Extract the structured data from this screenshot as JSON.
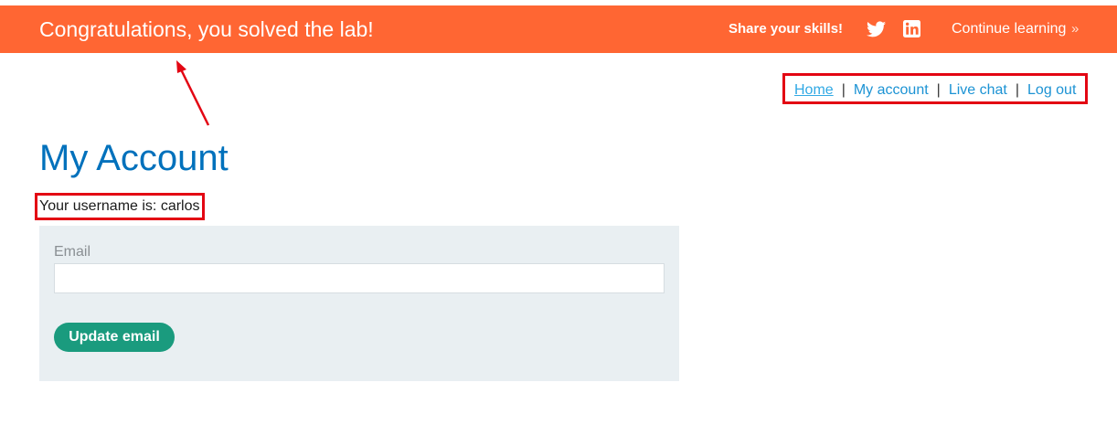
{
  "banner": {
    "message": "Congratulations, you solved the lab!",
    "share_label": "Share your skills!",
    "twitter_icon": "twitter-icon",
    "linkedin_icon": "linkedin-icon",
    "continue_label": "Continue learning",
    "continue_chevron": "»",
    "color": "#ff6633"
  },
  "nav": {
    "items": [
      {
        "label": "Home",
        "active": true
      },
      {
        "label": "My account"
      },
      {
        "label": "Live chat"
      },
      {
        "label": "Log out"
      }
    ],
    "separator": "|",
    "highlight_color": "#e30613"
  },
  "main": {
    "title": "My Account",
    "username_text": "Your username is: carlos"
  },
  "form": {
    "email_label": "Email",
    "email_value": "",
    "submit_label": "Update email",
    "button_color": "#1a9b7e"
  }
}
